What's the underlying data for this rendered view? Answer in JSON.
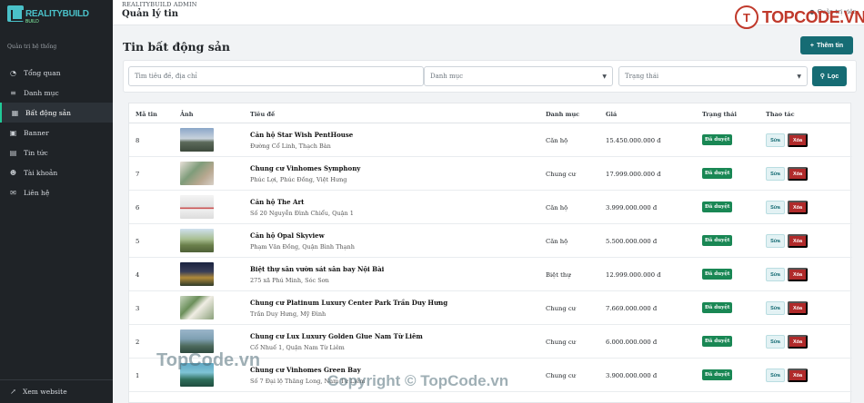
{
  "sidebar": {
    "brand_main": "REALITYBUILD",
    "brand_sub": "BUILD",
    "system_label": "Quản trị hệ thống",
    "items": [
      {
        "label": "Tổng quan",
        "icon": "gauge-icon"
      },
      {
        "label": "Danh mục",
        "icon": "layers-icon"
      },
      {
        "label": "Bất động sản",
        "icon": "building-icon"
      },
      {
        "label": "Banner",
        "icon": "image-icon"
      },
      {
        "label": "Tin tức",
        "icon": "newspaper-icon"
      },
      {
        "label": "Tài khoản",
        "icon": "users-icon"
      },
      {
        "label": "Liên hệ",
        "icon": "chat-icon"
      }
    ],
    "active_index": 2,
    "bottom_link": "Xem website"
  },
  "topbar": {
    "admin_label": "REALITYBUILD ADMIN",
    "title": "Quản lý tin",
    "user_label": "Quản trị viên"
  },
  "watermark": {
    "logo_text": "TOPCODE.VN",
    "bottom_left": "TopCode.vn",
    "bottom_center": "Copyright © TopCode.vn"
  },
  "page": {
    "title": "Tin bất động sản",
    "add_button": "Thêm tin"
  },
  "filter": {
    "search_placeholder": "Tìm tiêu đề, địa chỉ",
    "category_placeholder": "Danh mục",
    "status_placeholder": "Trạng thái",
    "filter_button": "Lọc"
  },
  "table": {
    "headers": {
      "id": "Mã tin",
      "image": "Ảnh",
      "title": "Tiêu đề",
      "category": "Danh mục",
      "price": "Giá",
      "status": "Trạng thái",
      "actions": "Thao tác"
    },
    "edit_label": "Sửa",
    "delete_label": "Xóa",
    "rows": [
      {
        "id": "8",
        "title": "Căn hộ Star Wish PentHouse",
        "address": "Đường Cổ Linh, Thạch Bàn",
        "category": "Căn hộ",
        "price": "15.450.000.000 đ",
        "status": "Đã duyệt"
      },
      {
        "id": "7",
        "title": "Chung cư Vinhomes Symphony",
        "address": "Phúc Lợi, Phúc Đồng, Việt Hưng",
        "category": "Chung cư",
        "price": "17.999.000.000 đ",
        "status": "Đã duyệt"
      },
      {
        "id": "6",
        "title": "Căn hộ The Art",
        "address": "Số 20 Nguyễn Đình Chiểu, Quận 1",
        "category": "Căn hộ",
        "price": "3.999.000.000 đ",
        "status": "Đã duyệt"
      },
      {
        "id": "5",
        "title": "Căn hộ Opal Skyview",
        "address": "Phạm Văn Đồng, Quận Bình Thạnh",
        "category": "Căn hộ",
        "price": "5.500.000.000 đ",
        "status": "Đã duyệt"
      },
      {
        "id": "4",
        "title": "Biệt thự sân vườn sát sân bay Nội Bài",
        "address": "275 xã Phú Minh, Sóc Sơn",
        "category": "Biệt thự",
        "price": "12.999.000.000 đ",
        "status": "Đã duyệt"
      },
      {
        "id": "3",
        "title": "Chung cư Platinum Luxury Center Park Trần Duy Hưng",
        "address": "Trần Duy Hưng, Mỹ Đình",
        "category": "Chung cư",
        "price": "7.669.000.000 đ",
        "status": "Đã duyệt"
      },
      {
        "id": "2",
        "title": "Chung cư Lux Luxury Golden Glue Nam Từ Liêm",
        "address": "Cổ Nhuế 1, Quận Nam Từ Liêm",
        "category": "Chung cư",
        "price": "6.000.000.000 đ",
        "status": "Đã duyệt"
      },
      {
        "id": "1",
        "title": "Chung cư Vinhomes Green Bay",
        "address": "Số 7 Đại lộ Thăng Long, Nam Từ Liêm",
        "category": "Chung cư",
        "price": "3.900.000.000 đ",
        "status": "Đã duyệt"
      }
    ]
  }
}
